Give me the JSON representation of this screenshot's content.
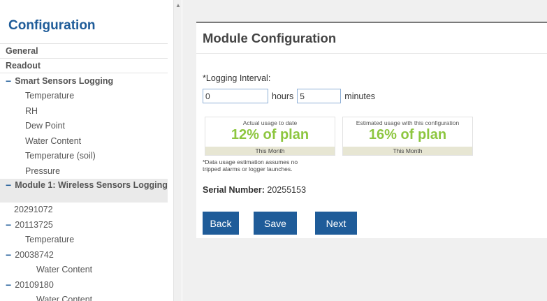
{
  "sidebar": {
    "title": "Configuration",
    "items": [
      {
        "label": "General",
        "kind": "top"
      },
      {
        "label": "Readout",
        "kind": "top"
      },
      {
        "label": "Smart Sensors Logging",
        "kind": "group"
      },
      {
        "label": "Temperature",
        "kind": "sub1"
      },
      {
        "label": "RH",
        "kind": "sub1"
      },
      {
        "label": "Dew Point",
        "kind": "sub1"
      },
      {
        "label": "Water Content",
        "kind": "sub1"
      },
      {
        "label": "Temperature (soil)",
        "kind": "sub1"
      },
      {
        "label": "Pressure",
        "kind": "sub1"
      },
      {
        "label": "Module 1: Wireless Sensors Logging",
        "kind": "module"
      },
      {
        "label": "20291072",
        "kind": "serial"
      },
      {
        "label": "20113725",
        "kind": "serial-group"
      },
      {
        "label": "Temperature",
        "kind": "sub3"
      },
      {
        "label": "20038742",
        "kind": "serial-group"
      },
      {
        "label": "Water Content",
        "kind": "sub3"
      },
      {
        "label": "20109180",
        "kind": "serial-group"
      },
      {
        "label": "Water Content",
        "kind": "sub3"
      }
    ]
  },
  "main": {
    "title": "Module Configuration",
    "interval_label": "*Logging Interval:",
    "hours_value": "0",
    "hours_unit": "hours",
    "minutes_value": "5",
    "minutes_unit": "minutes",
    "usage_actual": {
      "caption": "Actual usage to date",
      "value": "12% of plan",
      "footer": "This Month"
    },
    "usage_estimated": {
      "caption": "Estimated usage with this configuration",
      "value": "16% of plan",
      "footer": "This Month"
    },
    "note": "*Data usage estimation assumes no tripped alarms or logger launches.",
    "serial_label": "Serial Number:",
    "serial_value": "20255153",
    "buttons": {
      "back": "Back",
      "save": "Save",
      "next": "Next"
    }
  },
  "colors": {
    "accent": "#1f5c99",
    "usage_green": "#8dc63f"
  }
}
